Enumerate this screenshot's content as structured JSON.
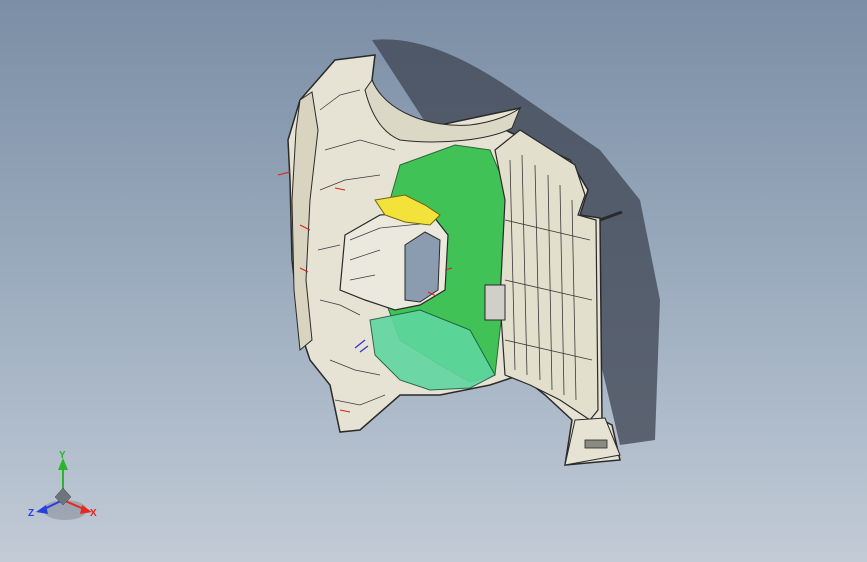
{
  "viewport": {
    "background_top": "#7b8ea5",
    "background_bottom": "#c2cbd6"
  },
  "model": {
    "part_colors": {
      "body": "#e6e3d4",
      "edge": "#2a2a2a",
      "green": "#2fbf4a",
      "teal": "#5fd6a0",
      "yellow": "#f2e23a",
      "shadow": "#3d4451"
    }
  },
  "triad": {
    "x_label": "X",
    "y_label": "Y",
    "z_label": "Z",
    "x_color": "#e8281e",
    "y_color": "#2ab52a",
    "z_color": "#2a3fe0"
  }
}
